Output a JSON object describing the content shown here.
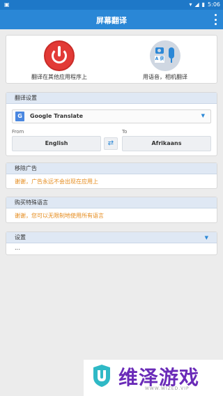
{
  "status": {
    "time": "5:06"
  },
  "appbar": {
    "title": "屏幕翻译"
  },
  "top": {
    "left_label": "翻译在其他应用程序上",
    "right_label": "用语音，相机翻译",
    "voice_icon_text": "A 获"
  },
  "translate": {
    "header": "翻译设置",
    "engine": "Google Translate",
    "engine_icon_text": "G",
    "from_label": "From",
    "to_label": "To",
    "from_lang": "English",
    "to_lang": "Afrikaans"
  },
  "ads": {
    "header": "移除广告",
    "text": "谢谢，广告永远不会出现在应用上"
  },
  "buy": {
    "header": "购买特殊语言",
    "text": "谢谢，您可以无限制地使用所有语言"
  },
  "settings": {
    "header": "设置",
    "more": "..."
  },
  "watermark": {
    "text": "维泽游戏",
    "sub": "WWW.WIZED.VIP"
  },
  "colors": {
    "primary": "#2a87d6",
    "accent_text": "#e58a1a",
    "power": "#e23a36"
  }
}
